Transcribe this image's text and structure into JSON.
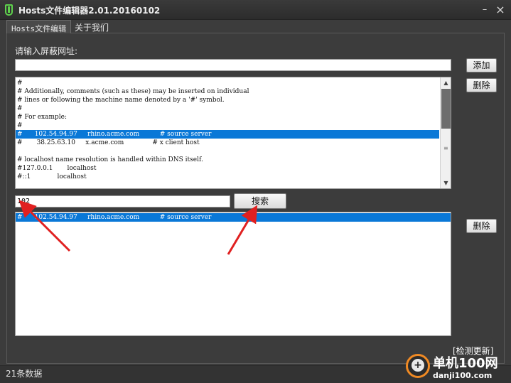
{
  "window": {
    "title": "Hosts文件编辑器2.01.20160102",
    "minimize_glyph": "–",
    "close_glyph": "×"
  },
  "tabs": [
    {
      "label": "Hosts文件编辑",
      "active": true
    },
    {
      "label": "关于我们",
      "active": false
    }
  ],
  "form": {
    "url_label": "请输入屏蔽网址:",
    "url_value": "",
    "add_label": "添加",
    "delete_label": "删除",
    "search_value": "102",
    "search_label": "搜索",
    "results_delete_label": "删除"
  },
  "hosts_lines": [
    "#",
    "# Additionally, comments (such as these) may be inserted on individual",
    "# lines or following the machine name denoted by a '#' symbol.",
    "#",
    "# For example:",
    "#",
    "#      102.54.94.97     rhino.acme.com          # source server",
    "#       38.25.63.10     x.acme.com              # x client host",
    "",
    "# localhost name resolution is handled within DNS itself.",
    "#127.0.0.1       localhost",
    "#::1             localhost"
  ],
  "selected_line_index": 6,
  "search_results": [
    "#      102.54.94.97     rhino.acme.com          # source server"
  ],
  "footer": {
    "update_label": "[检测更新]",
    "status": "21条数据"
  },
  "watermark": {
    "name": "单机100网",
    "url": "danji100.com"
  },
  "colors": {
    "selection": "#0a78d7",
    "arrow": "#e02020",
    "watermark_ring": "#f08a24"
  }
}
